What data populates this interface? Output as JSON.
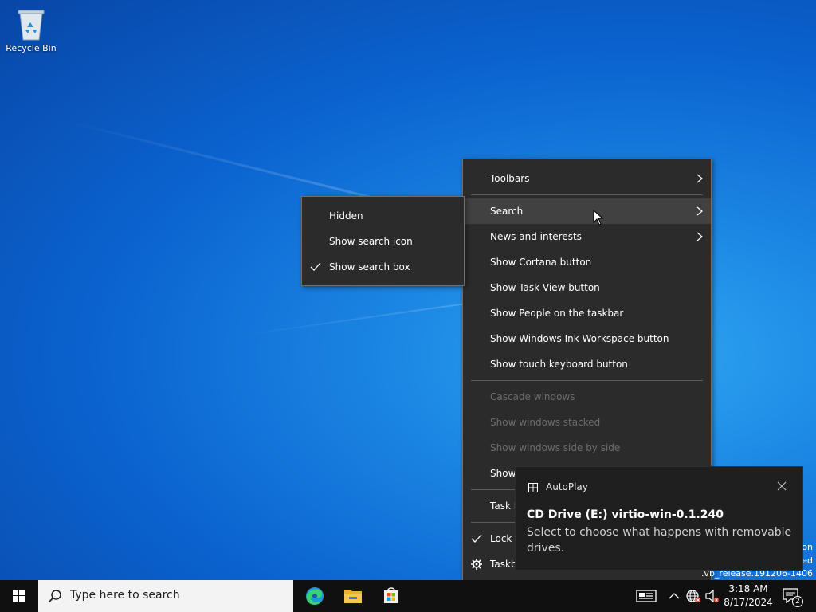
{
  "desktop": {
    "icons": [
      {
        "label": "Recycle Bin",
        "icon": "recycle-bin-icon"
      }
    ]
  },
  "taskbar_menu": {
    "items": [
      {
        "label": "Toolbars"
      },
      {
        "label": "Search"
      },
      {
        "label": "News and interests"
      },
      {
        "label": "Show Cortana button"
      },
      {
        "label": "Show Task View button"
      },
      {
        "label": "Show People on the taskbar"
      },
      {
        "label": "Show Windows Ink Workspace button"
      },
      {
        "label": "Show touch keyboard button"
      },
      {
        "label": "Cascade windows"
      },
      {
        "label": "Show windows stacked"
      },
      {
        "label": "Show windows side by side"
      },
      {
        "label": "Show"
      },
      {
        "label": "Task M"
      },
      {
        "label": "Lock"
      },
      {
        "label": "Taskb"
      }
    ]
  },
  "search_submenu": {
    "items": [
      {
        "label": "Hidden"
      },
      {
        "label": "Show search icon"
      },
      {
        "label": "Show search box",
        "checked": true
      }
    ]
  },
  "watermark": {
    "lines": [
      "on",
      "ed",
      ".vb_release.191206-1406"
    ]
  },
  "toast": {
    "app": "AutoPlay",
    "title": "CD Drive (E:) virtio-win-0.1.240",
    "body": "Select to choose what happens with removable drives."
  },
  "taskbar": {
    "search_placeholder": "Type here to search",
    "apps": [
      "edge-icon",
      "file-explorer-icon",
      "microsoft-store-icon"
    ],
    "clock": {
      "time": "3:18 AM",
      "date": "8/17/2024"
    },
    "notification_count": "2"
  },
  "colors": {
    "menu_bg": "#2b2b2b",
    "menu_hover": "#414141",
    "disabled_text": "#6c6c6c",
    "taskbar_bg": "#101010"
  }
}
